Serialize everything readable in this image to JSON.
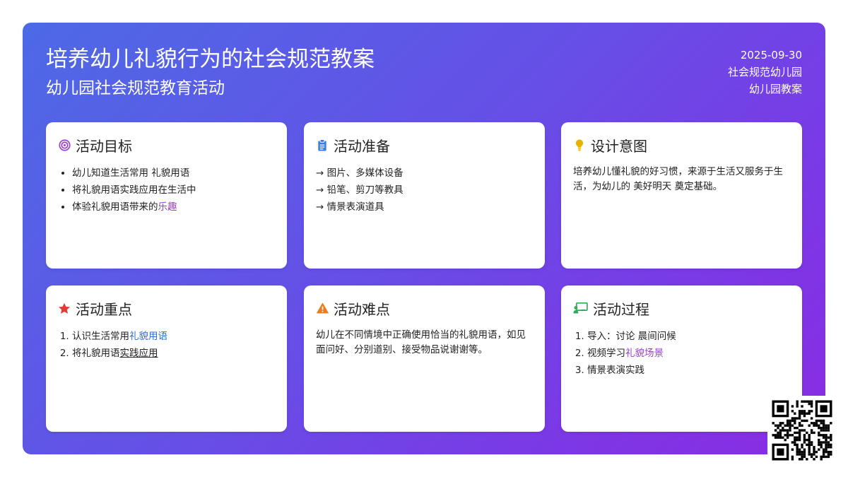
{
  "header": {
    "title": "培养幼儿礼貌行为的社会规范教案",
    "subtitle": "幼儿园社会规范教育活动",
    "date": "2025-09-30",
    "school": "社会规范幼儿园",
    "doc_type": "幼儿园教案"
  },
  "cards": {
    "goals": {
      "icon": "target-icon",
      "title": "活动目标",
      "items": [
        "幼儿知道生活常用 礼貌用语",
        "将礼貌用语实践应用在生活中"
      ],
      "item3_prefix": "体验礼貌用语带来的",
      "item3_highlight": "乐趣"
    },
    "prep": {
      "icon": "clipboard-icon",
      "title": "活动准备",
      "items": [
        "→ 图片、多媒体设备",
        "→ 铅笔、剪刀等教具",
        "→ 情景表演道具"
      ]
    },
    "intent": {
      "icon": "lightbulb-icon",
      "title": "设计意图",
      "text": "培养幼儿懂礼貌的好习惯，来源于生活又服务于生活，为幼儿的 美好明天 奠定基础。"
    },
    "key": {
      "icon": "star-icon",
      "title": "活动重点",
      "item1_prefix": "认识生活常用",
      "item1_highlight": "礼貌用语",
      "item2_prefix": "将礼貌用语",
      "item2_highlight": "实践应用"
    },
    "difficulty": {
      "icon": "warning-icon",
      "title": "活动难点",
      "text": "幼儿在不同情境中正确使用恰当的礼貌用语，如见面问好、分别道别、接受物品说谢谢等。"
    },
    "process": {
      "icon": "teacher-icon",
      "title": "活动过程",
      "item1": "导入：讨论 晨间问候",
      "item2_prefix": "视频学习",
      "item2_highlight": "礼貌场景",
      "item3": "情景表演实践"
    }
  },
  "colors": {
    "gradient_start": "#4d6ae5",
    "gradient_end": "#8a2be2",
    "highlight_purple": "#9b3fd6",
    "highlight_blue": "#2f6fd8",
    "icon_target": "#9b3fd6",
    "icon_clipboard": "#3b7be0",
    "icon_lightbulb": "#e6b400",
    "icon_star": "#e53935",
    "icon_warning": "#f07b1a",
    "icon_teacher": "#2fae5a"
  },
  "qr": {
    "icon": "qr-code-icon"
  }
}
